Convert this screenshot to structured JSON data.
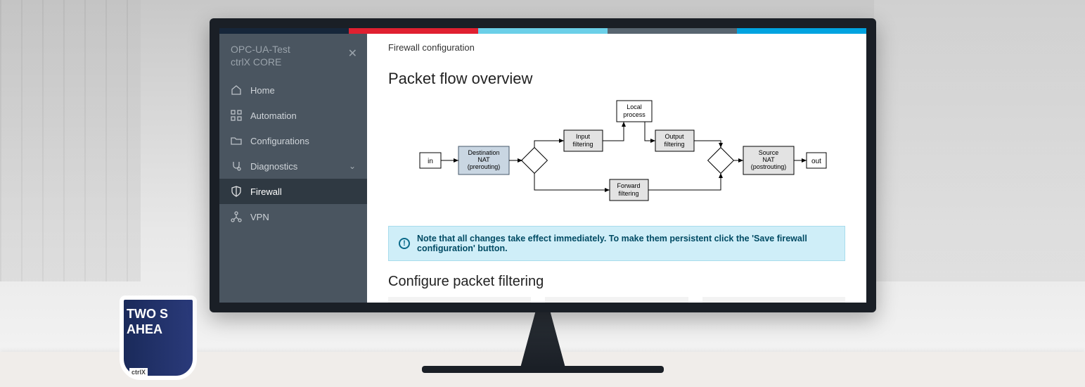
{
  "office": {
    "mug_line1": "TWO S",
    "mug_line2": "AHEA",
    "mug_brand": "ctrlX"
  },
  "sidebar": {
    "title_line1": "OPC-UA-Test",
    "title_line2": "ctrlX CORE",
    "items": [
      {
        "label": "Home",
        "icon": "home-icon"
      },
      {
        "label": "Automation",
        "icon": "grid-icon"
      },
      {
        "label": "Configurations",
        "icon": "folder-icon"
      },
      {
        "label": "Diagnostics",
        "icon": "stethoscope-icon",
        "expandable": true
      },
      {
        "label": "Firewall",
        "icon": "shield-icon",
        "active": true
      },
      {
        "label": "VPN",
        "icon": "network-icon"
      }
    ]
  },
  "main": {
    "breadcrumb": "Firewall configuration",
    "overview_title": "Packet flow overview",
    "info_note": "Note that all changes take effect immediately. To make them persistent click the 'Save firewall configuration' button.",
    "configure_title": "Configure packet filtering"
  },
  "diagram": {
    "in": "in",
    "dest_nat": "Destination\nNAT\n(prerouting)",
    "input_filter": "Input\nfiltering",
    "local_process": "Local\nprocess",
    "output_filter": "Output\nfiltering",
    "forward_filter": "Forward\nfiltering",
    "source_nat": "Source\nNAT\n(postrouting)",
    "out": "out"
  }
}
